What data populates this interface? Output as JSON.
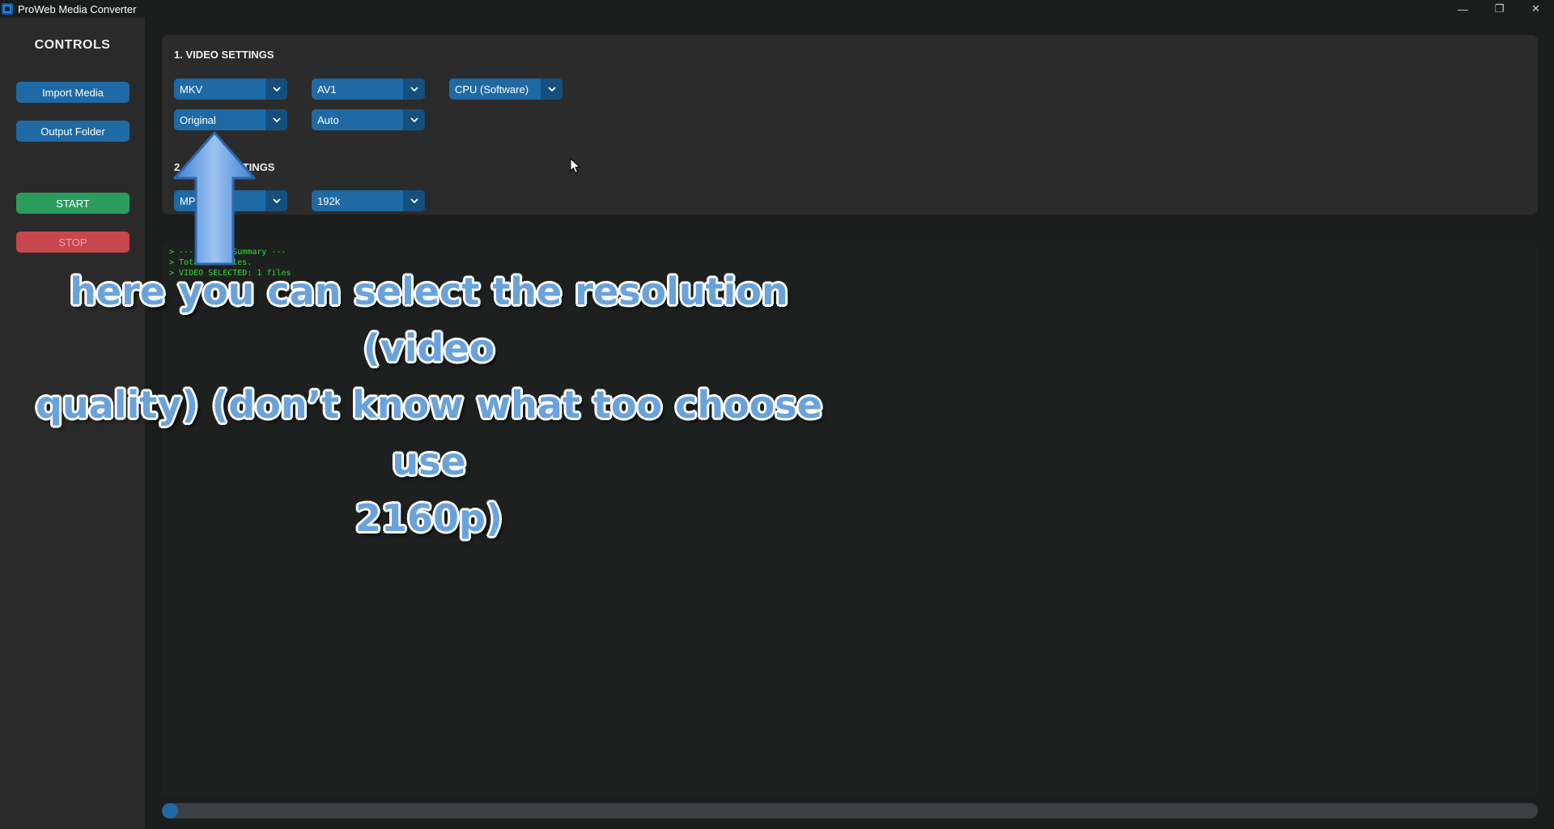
{
  "window": {
    "title": "ProWeb Media Converter",
    "minimize": "—",
    "maximize": "❐",
    "close": "✕"
  },
  "sidebar": {
    "title": "CONTROLS",
    "import_label": "Import Media",
    "output_label": "Output Folder",
    "start_label": "START",
    "stop_label": "STOP"
  },
  "video_settings": {
    "title": "1. VIDEO SETTINGS",
    "container": "MKV",
    "codec": "AV1",
    "encoder": "CPU (Software)",
    "resolution": "Original",
    "fps": "Auto"
  },
  "audio_settings": {
    "title": "2. AUDIO SETTINGS",
    "format": "MP3",
    "bitrate": "192k"
  },
  "log": {
    "lines": [
      "> --- Import Summary ---",
      "> Total: 1 files.",
      "> VIDEO SELECTED: 1 files"
    ]
  },
  "progress": {
    "value": 0.01
  },
  "annotation": {
    "line1": "here you can select the resolution (video",
    "line2": "quality) (don’t know what too choose use",
    "line3": "2160p)"
  },
  "colors": {
    "accent": "#1f6aa5",
    "start": "#2a9d5c",
    "stop": "#c8464e",
    "log_text": "#2ee02e"
  }
}
